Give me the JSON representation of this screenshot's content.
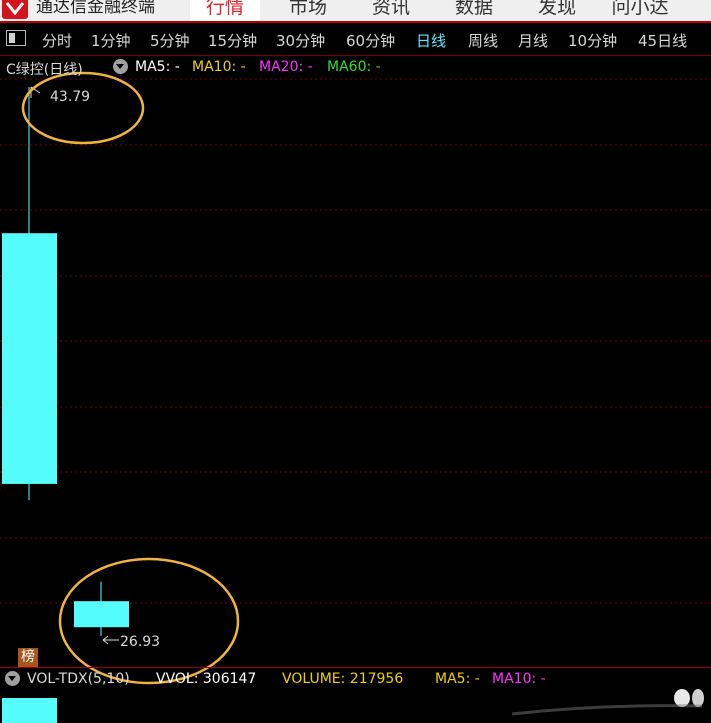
{
  "app": {
    "title": "通达信金融终端",
    "menu": [
      "行情",
      "市场",
      "资讯",
      "数据",
      "发现",
      "问小达"
    ],
    "active_menu": "行情"
  },
  "periods": [
    "分时",
    "1分钟",
    "5分钟",
    "15分钟",
    "30分钟",
    "60分钟",
    "日线",
    "周线",
    "月线",
    "10分钟",
    "45日线"
  ],
  "active_period": "日线",
  "indicator": {
    "stock_label": "C绿控(日线)",
    "ma5": "MA5: -",
    "ma10": "MA10: -",
    "ma20": "MA20: -",
    "ma60": "MA60: -",
    "colors": {
      "ma5": "#ffffff",
      "ma10": "#f0d000",
      "ma20": "#ff30ff",
      "ma60": "#30e030"
    }
  },
  "badge": "榜",
  "volume": {
    "label": "VOL-TDX(5,10)",
    "vvol": "VVOL: 306147",
    "volume": "VOLUME: 217956",
    "ma5": "MA5: -",
    "ma10": "MA10: -",
    "colors": {
      "vvol": "#ffffff",
      "volume": "#f0d000",
      "ma5": "#f0d000",
      "ma10": "#ff30ff"
    }
  },
  "chart_data": {
    "type": "candlestick",
    "high_label": "43.79",
    "low_label": "26.93",
    "price_range": [
      26.93,
      43.79
    ],
    "candles": [
      {
        "open": 39.3,
        "close": 31.6,
        "high": 43.79,
        "low": 31.1,
        "color": "#54fcfc"
      },
      {
        "open": 28.0,
        "close": 27.2,
        "high": 28.6,
        "low": 26.93,
        "color": "#54fcfc"
      }
    ]
  }
}
